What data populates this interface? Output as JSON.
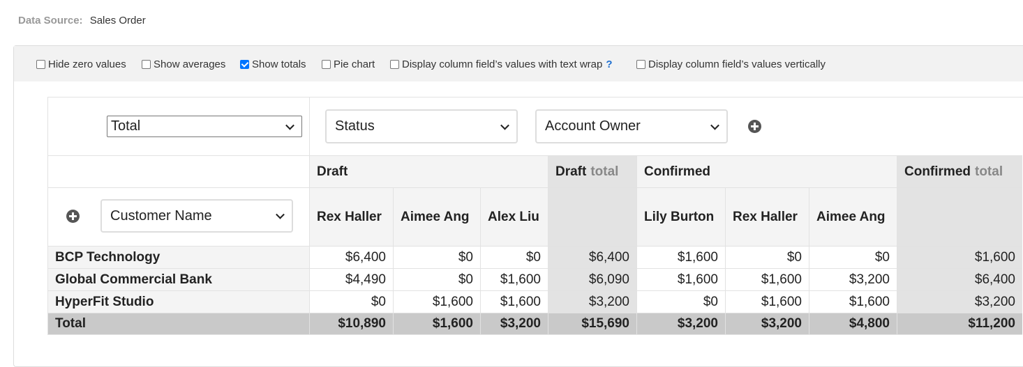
{
  "data_source": {
    "label": "Data Source:",
    "value": "Sales Order"
  },
  "options": [
    {
      "label": "Hide zero values",
      "checked": false
    },
    {
      "label": "Show averages",
      "checked": false
    },
    {
      "label": "Show totals",
      "checked": true
    },
    {
      "label": "Pie chart",
      "checked": false
    },
    {
      "label": "Display column field’s values with text wrap",
      "checked": false,
      "help": "?"
    },
    {
      "label": "Display column field’s values vertically",
      "checked": false
    }
  ],
  "selectors": {
    "aggregate": "Total",
    "column_field_1": "Status",
    "column_field_2": "Account Owner",
    "row_field": "Customer Name"
  },
  "groups": [
    {
      "name": "Draft"
    },
    {
      "name": "Draft",
      "suffix": "total"
    },
    {
      "name": "Confirmed"
    },
    {
      "name": "Confirmed",
      "suffix": "total"
    }
  ],
  "columns": [
    "Rex Haller",
    "Aimee Ang",
    "Alex Liu",
    "",
    "Lily Burton",
    "Rex Haller",
    "Aimee Ang",
    ""
  ],
  "rows": [
    {
      "label": "BCP Technology",
      "values": [
        "$6,400",
        "$0",
        "$0",
        "$6,400",
        "$1,600",
        "$0",
        "$0",
        "$1,600"
      ]
    },
    {
      "label": "Global Commercial Bank",
      "values": [
        "$4,490",
        "$0",
        "$1,600",
        "$6,090",
        "$1,600",
        "$1,600",
        "$3,200",
        "$6,400"
      ]
    },
    {
      "label": "HyperFit Studio",
      "values": [
        "$0",
        "$1,600",
        "$1,600",
        "$3,200",
        "$0",
        "$1,600",
        "$1,600",
        "$3,200"
      ]
    }
  ],
  "total_row": {
    "label": "Total",
    "values": [
      "$10,890",
      "$1,600",
      "$3,200",
      "$15,690",
      "$3,200",
      "$3,200",
      "$4,800",
      "$11,200"
    ]
  }
}
